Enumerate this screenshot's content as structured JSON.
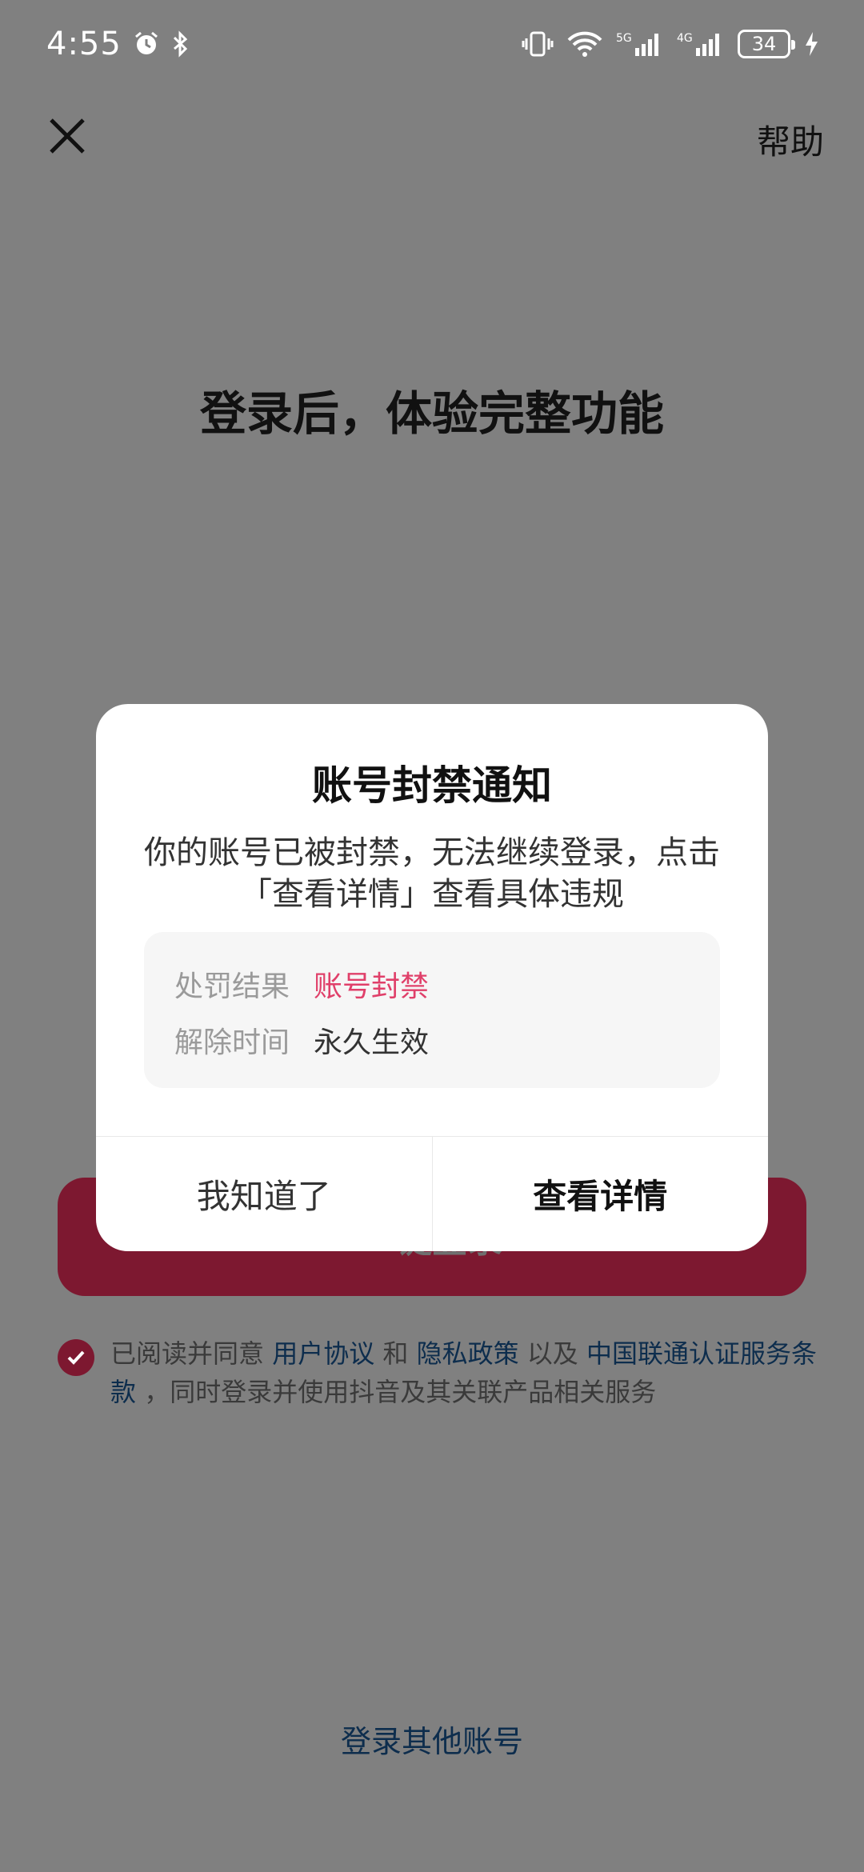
{
  "status_bar": {
    "time": "4:55",
    "battery": "34",
    "icons": [
      "alarm-icon",
      "bluetooth-icon",
      "vibrate-icon",
      "wifi-icon",
      "5g-signal-icon",
      "4g-signal-icon",
      "battery-icon",
      "charging-icon"
    ]
  },
  "nav": {
    "close_icon": "close-icon",
    "help_label": "帮助"
  },
  "headline": "登录后，体验完整功能",
  "login_button_label": "一键登录",
  "agreement": {
    "prefix": "已阅读并同意 ",
    "user_agreement": "用户协议",
    "and": " 和 ",
    "privacy_policy": "隐私政策",
    "as_well_as": " 以及 ",
    "unicom_terms": "中国联通认证服务条款",
    "suffix": " ，同时登录并使用抖音及其关联产品相关服务"
  },
  "other_login_label": "登录其他账号",
  "modal": {
    "title": "账号封禁通知",
    "description": "你的账号已被封禁，无法继续登录，点击「查看详情」查看具体违规",
    "rows": [
      {
        "label": "处罚结果",
        "value": "账号封禁"
      },
      {
        "label": "解除时间",
        "value": "永久生效"
      }
    ],
    "dismiss_label": "我知道了",
    "details_label": "查看详情"
  },
  "colors": {
    "overlay_bg": "#808080",
    "brand": "#7d1830",
    "warn_text": "#e0406a",
    "link": "#0d2d4d"
  }
}
